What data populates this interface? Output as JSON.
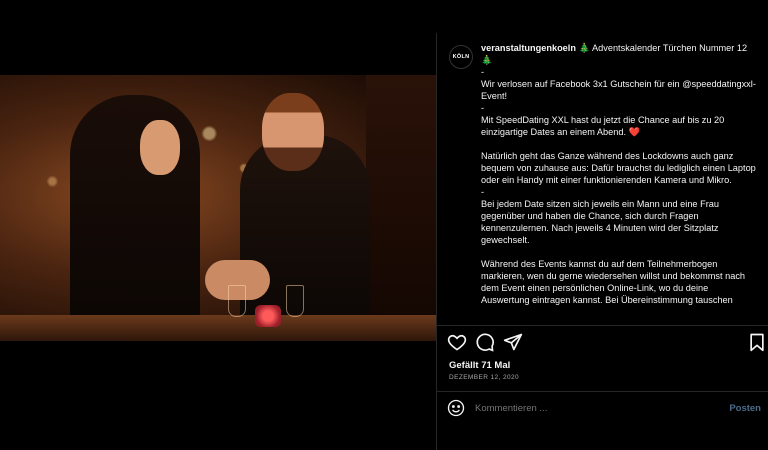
{
  "post": {
    "avatar_text": "KÖLN",
    "username": "veranstaltungenkoeln",
    "caption_text": " 🎄 Adventskalender Türchen Nummer 12🎄\n-\nWir verlosen auf Facebook 3x1 Gutschein für ein @speeddatingxxl-Event!\n-\nMit SpeedDating XXL hast du jetzt die Chance auf bis zu 20 einzigartige Dates an einem Abend. ❤️\n\nNatürlich geht das Ganze während des Lockdowns auch ganz bequem von zuhause aus: Dafür brauchst du lediglich einen Laptop oder ein Handy mit einer funktionierenden Kamera und Mikro.\n-\nBei jedem Date sitzen sich jeweils ein Mann und eine Frau gegenüber und haben die Chance, sich durch Fragen kennenzulernen. Nach jeweils 4 Minuten wird der Sitzplatz gewechselt.\n\nWährend des Events kannst du auf dem Teilnehmerbogen markieren, wen du gerne wiedersehen willst und bekommst nach dem Event einen persönlichen Online-Link, wo du deine Auswertung eintragen kannst. Bei Übereinstimmung tauschen",
    "likes": "Gefällt 71 Mal",
    "date": "DEZEMBER 12, 2020"
  },
  "actions": {
    "icons": [
      "heart-icon",
      "comment-icon",
      "share-icon",
      "bookmark-icon"
    ]
  },
  "comment": {
    "placeholder": "Kommentieren ...",
    "post_label": "Posten"
  },
  "colors": {
    "background": "#000000",
    "text": "#f5f5f5",
    "muted": "#a8a8a8",
    "post_button": "#4a6b8a"
  }
}
